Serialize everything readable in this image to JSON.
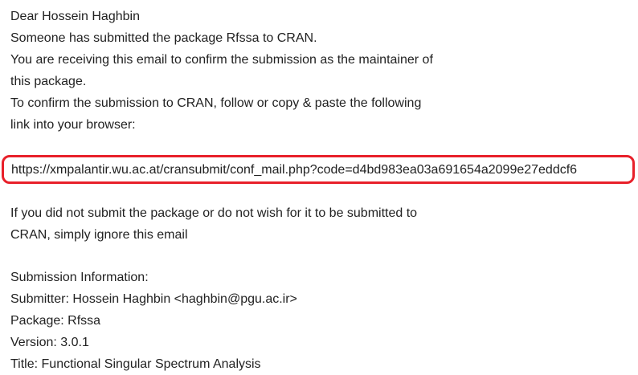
{
  "email": {
    "greeting": "Dear Hossein Haghbin",
    "intro_lines": [
      "Someone has submitted the package Rfssa to CRAN.",
      "You are receiving this email to confirm the submission as the maintainer of",
      "this package.",
      "To confirm the submission to CRAN, follow or copy & paste the following",
      "link into your browser:"
    ],
    "confirm_link": "https://xmpalantir.wu.ac.at/cransubmit/conf_mail.php?code=d4bd983ea03a691654a2099e27eddcf6",
    "ignore_lines": [
      "If you did not submit the package or do not wish for it to be submitted to",
      "CRAN, simply ignore this email"
    ],
    "submission": {
      "heading": "Submission Information:",
      "submitter": "Submitter: Hossein Haghbin <haghbin@pgu.ac.ir>",
      "package": "Package: Rfssa",
      "version": "Version: 3.0.1",
      "title": "Title: Functional Singular Spectrum Analysis"
    },
    "highlight_color": "#e8202a"
  }
}
